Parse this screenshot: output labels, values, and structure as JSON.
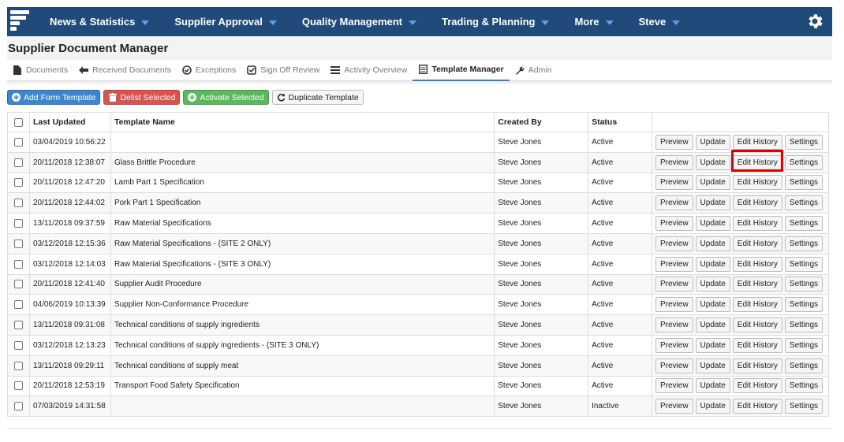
{
  "nav": {
    "items": [
      "News & Statistics",
      "Supplier Approval",
      "Quality Management",
      "Trading & Planning",
      "More",
      "Steve"
    ]
  },
  "page": {
    "title": "Supplier Document Manager"
  },
  "tabs": [
    {
      "label": "Documents",
      "icon": "file-icon"
    },
    {
      "label": "Received Documents",
      "icon": "arrow-left-icon"
    },
    {
      "label": "Exceptions",
      "icon": "check-circle-icon"
    },
    {
      "label": "Sign Off Review",
      "icon": "check-square-icon"
    },
    {
      "label": "Activity Overview",
      "icon": "list-icon"
    },
    {
      "label": "Template Manager",
      "icon": "table-icon",
      "active": true
    },
    {
      "label": "Admin",
      "icon": "wrench-icon"
    }
  ],
  "toolbar": {
    "add": "Add Form Template",
    "delist": "Delist Selected",
    "activate": "Activate Selected",
    "duplicate": "Duplicate Template"
  },
  "table": {
    "headers": [
      "Last Updated",
      "Template Name",
      "Created By",
      "Status"
    ],
    "actions": [
      "Preview",
      "Update",
      "Edit History",
      "Settings"
    ],
    "rows": [
      {
        "updated": "03/04/2019 10:56:22",
        "name": "",
        "by": "Steve Jones",
        "status": "Active"
      },
      {
        "updated": "20/11/2018 12:38:07",
        "name": "Glass Brittle Procedure",
        "by": "Steve Jones",
        "status": "Active"
      },
      {
        "updated": "20/11/2018 12:47:20",
        "name": "Lamb Part 1 Specification",
        "by": "Steve Jones",
        "status": "Active"
      },
      {
        "updated": "20/11/2018 12:44:02",
        "name": "Pork Part 1 Specification",
        "by": "Steve Jones",
        "status": "Active"
      },
      {
        "updated": "13/11/2018 09:37:59",
        "name": "Raw Material Specifications",
        "by": "Steve Jones",
        "status": "Active"
      },
      {
        "updated": "03/12/2018 12:15:36",
        "name": "Raw Material Specifications - (SITE 2 ONLY)",
        "by": "Steve Jones",
        "status": "Active"
      },
      {
        "updated": "03/12/2018 12:14:03",
        "name": "Raw Material Specifications - (SITE 3 ONLY)",
        "by": "Steve Jones",
        "status": "Active"
      },
      {
        "updated": "20/11/2018 12:41:40",
        "name": "Supplier Audit Procedure",
        "by": "Steve Jones",
        "status": "Active"
      },
      {
        "updated": "04/06/2019 10:13:39",
        "name": "Supplier Non-Conformance Procedure",
        "by": "Steve Jones",
        "status": "Active"
      },
      {
        "updated": "13/11/2018 09:31:08",
        "name": "Technical conditions of supply ingredients",
        "by": "Steve Jones",
        "status": "Active"
      },
      {
        "updated": "03/12/2018 12:13:23",
        "name": "Technical conditions of supply ingredients - (SITE 3 ONLY)",
        "by": "Steve Jones",
        "status": "Active"
      },
      {
        "updated": "13/11/2018 09:29:11",
        "name": "Technical conditions of supply meat",
        "by": "Steve Jones",
        "status": "Active"
      },
      {
        "updated": "20/11/2018 12:53:19",
        "name": "Transport Food Safety Specification",
        "by": "Steve Jones",
        "status": "Active"
      },
      {
        "updated": "07/03/2019 14:31:58",
        "name": "",
        "by": "Steve Jones",
        "status": "Inactive"
      }
    ]
  },
  "highlight": {
    "color": "#e00000",
    "target": "Edit History (row 2)"
  }
}
